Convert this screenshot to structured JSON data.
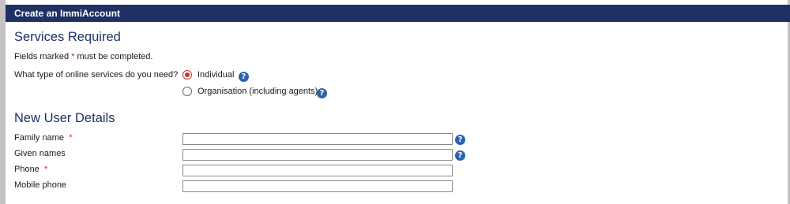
{
  "header": {
    "title": "Create an ImmiAccount"
  },
  "services": {
    "heading": "Services Required",
    "note_prefix": "Fields marked ",
    "required_marker": "*",
    "note_suffix": " must be completed.",
    "question": "What type of online services do you need?",
    "options": [
      {
        "label": "Individual",
        "selected": true
      },
      {
        "label": "Organisation (including agents)",
        "selected": false
      }
    ]
  },
  "user_details": {
    "heading": "New User Details",
    "fields": [
      {
        "label": "Family name",
        "required": true,
        "value": "",
        "help": true
      },
      {
        "label": "Given names",
        "required": false,
        "value": "",
        "help": true
      },
      {
        "label": "Phone",
        "required": true,
        "value": "",
        "help": false
      },
      {
        "label": "Mobile phone",
        "required": false,
        "value": "",
        "help": false
      }
    ]
  },
  "icons": {
    "help": "question-mark-help-icon"
  },
  "colors": {
    "header_bg": "#1e3165",
    "heading": "#1e3165",
    "required": "#d0271d",
    "help_icon": "#2a63b0",
    "radio_selected": "#c0392b"
  }
}
